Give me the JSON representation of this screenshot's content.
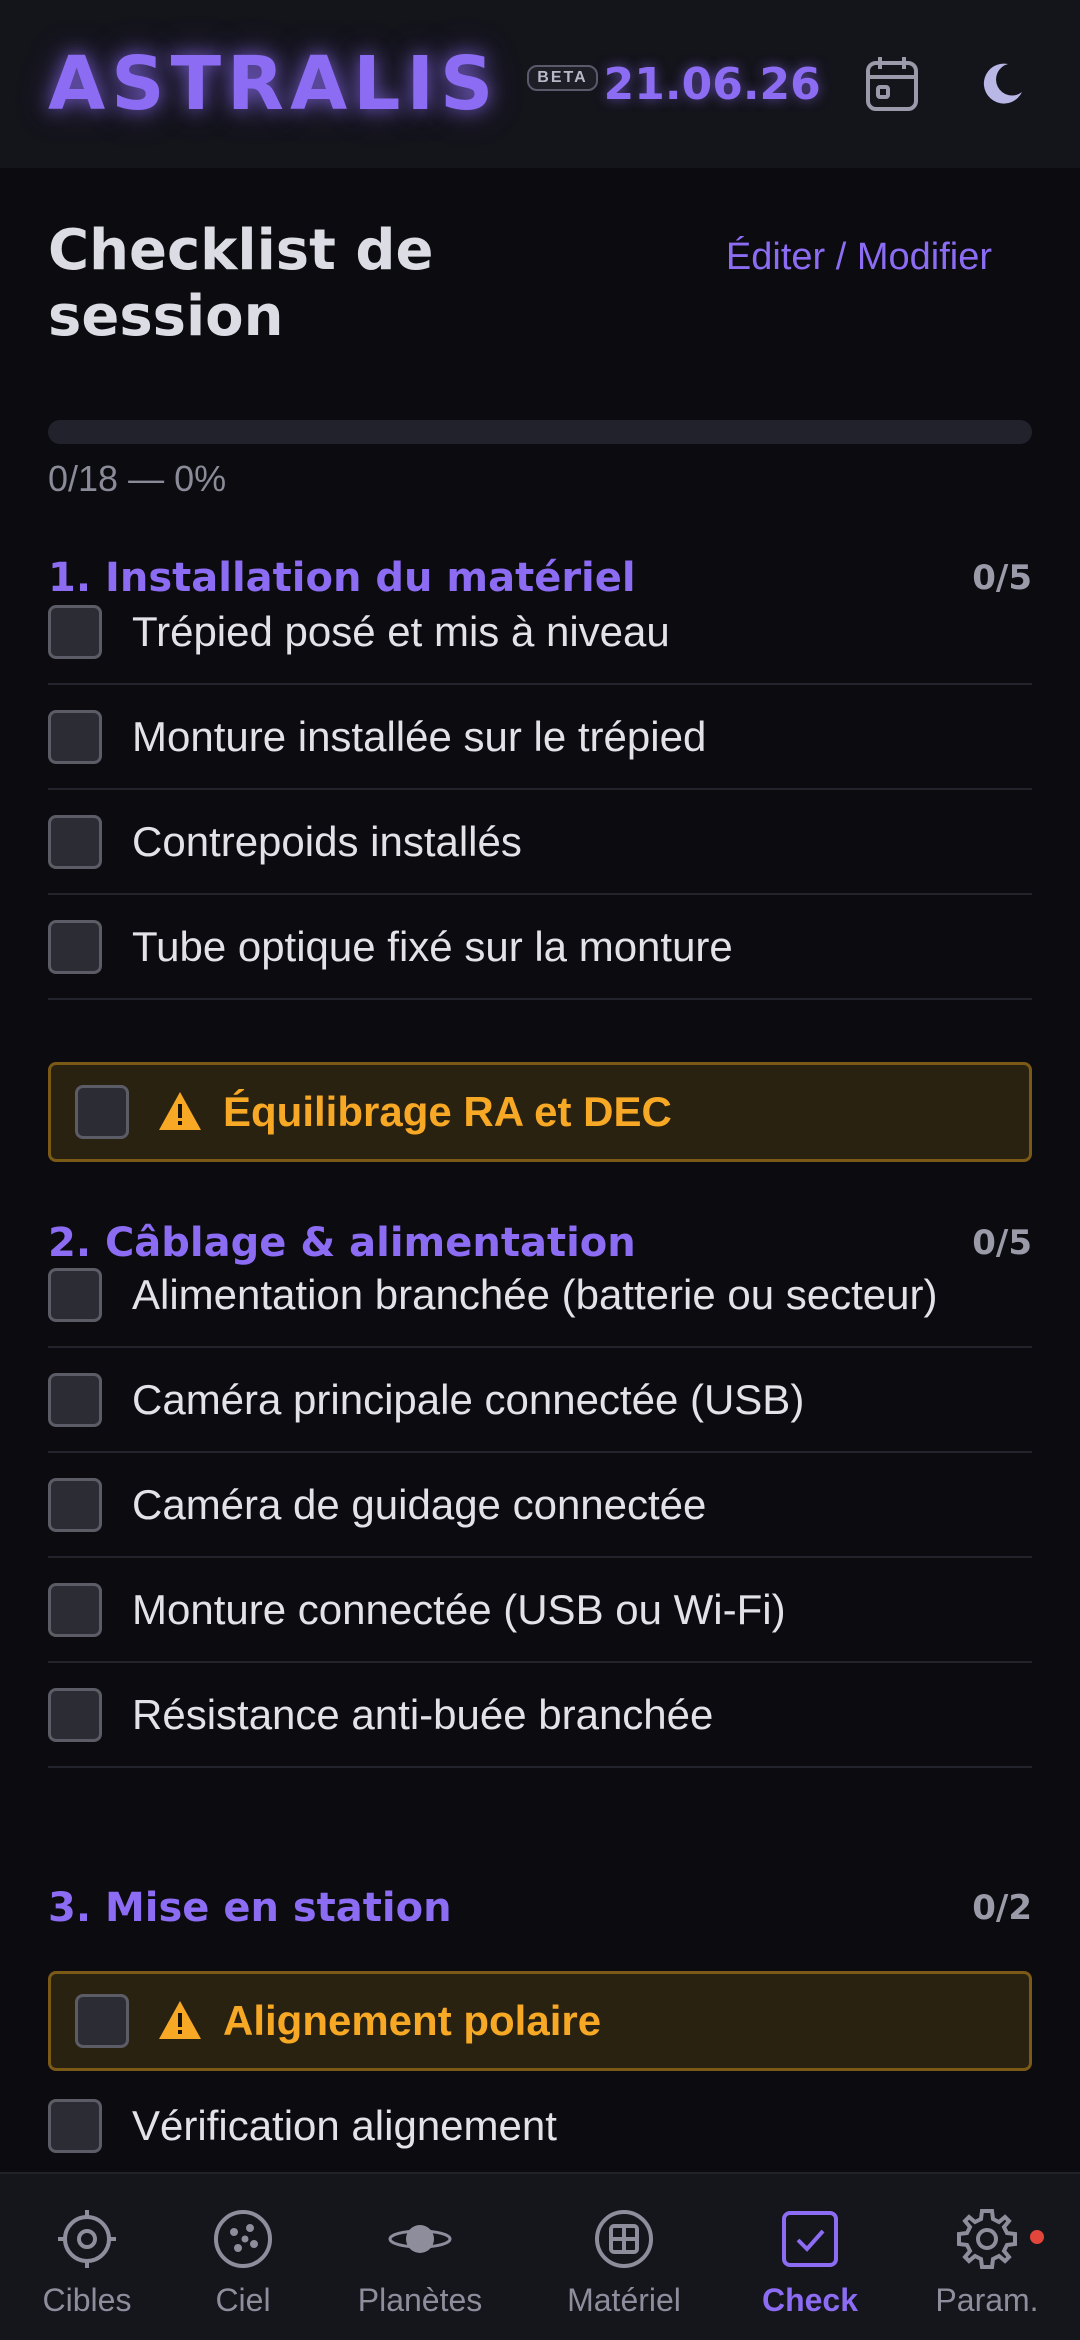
{
  "header": {
    "logo": "ASTRALIS",
    "badge": "BETA",
    "date": "21.06.26",
    "calendar_icon": "calendar-icon",
    "theme_icon": "moon-icon"
  },
  "page": {
    "title": "Checklist de session",
    "edit_label": "Éditer / Modifier",
    "progress_text": "0/18 — 0%",
    "progress_fraction": 0
  },
  "sections": [
    {
      "title": "1. Installation du matériel",
      "count": "0/5",
      "items": [
        {
          "label": "Trépied posé et mis à niveau",
          "warning": false,
          "checked": false
        },
        {
          "label": "Monture installée sur le trépied",
          "warning": false,
          "checked": false
        },
        {
          "label": "Contrepoids installés",
          "warning": false,
          "checked": false
        },
        {
          "label": "Tube optique fixé sur la monture",
          "warning": false,
          "checked": false
        },
        {
          "label": "Équilibrage RA et DEC",
          "warning": true,
          "checked": false
        }
      ]
    },
    {
      "title": "2. Câblage & alimentation",
      "count": "0/5",
      "items": [
        {
          "label": "Alimentation branchée (batterie ou secteur)",
          "warning": false,
          "checked": false
        },
        {
          "label": "Caméra principale connectée (USB)",
          "warning": false,
          "checked": false
        },
        {
          "label": "Caméra de guidage connectée",
          "warning": false,
          "checked": false
        },
        {
          "label": "Monture connectée (USB ou Wi-Fi)",
          "warning": false,
          "checked": false
        },
        {
          "label": "Résistance anti-buée branchée",
          "warning": false,
          "checked": false
        }
      ]
    },
    {
      "title": "3. Mise en station",
      "count": "0/2",
      "items": [
        {
          "label": "Alignement polaire",
          "warning": true,
          "checked": false
        },
        {
          "label": "Vérification alignement",
          "warning": false,
          "checked": false
        }
      ]
    }
  ],
  "nav": [
    {
      "label": "Cibles",
      "icon": "target-icon",
      "active": false
    },
    {
      "label": "Ciel",
      "icon": "sky-icon",
      "active": false
    },
    {
      "label": "Planètes",
      "icon": "planet-icon",
      "active": false
    },
    {
      "label": "Matériel",
      "icon": "equipment-icon",
      "active": false
    },
    {
      "label": "Check",
      "icon": "check-icon",
      "active": true
    },
    {
      "label": "Param.",
      "icon": "gear-icon",
      "active": false,
      "notification": true
    }
  ],
  "colors": {
    "accent": "#8b6cf2",
    "warning": "#f7a825",
    "background": "#0b0b10",
    "notification": "#e2463a"
  }
}
